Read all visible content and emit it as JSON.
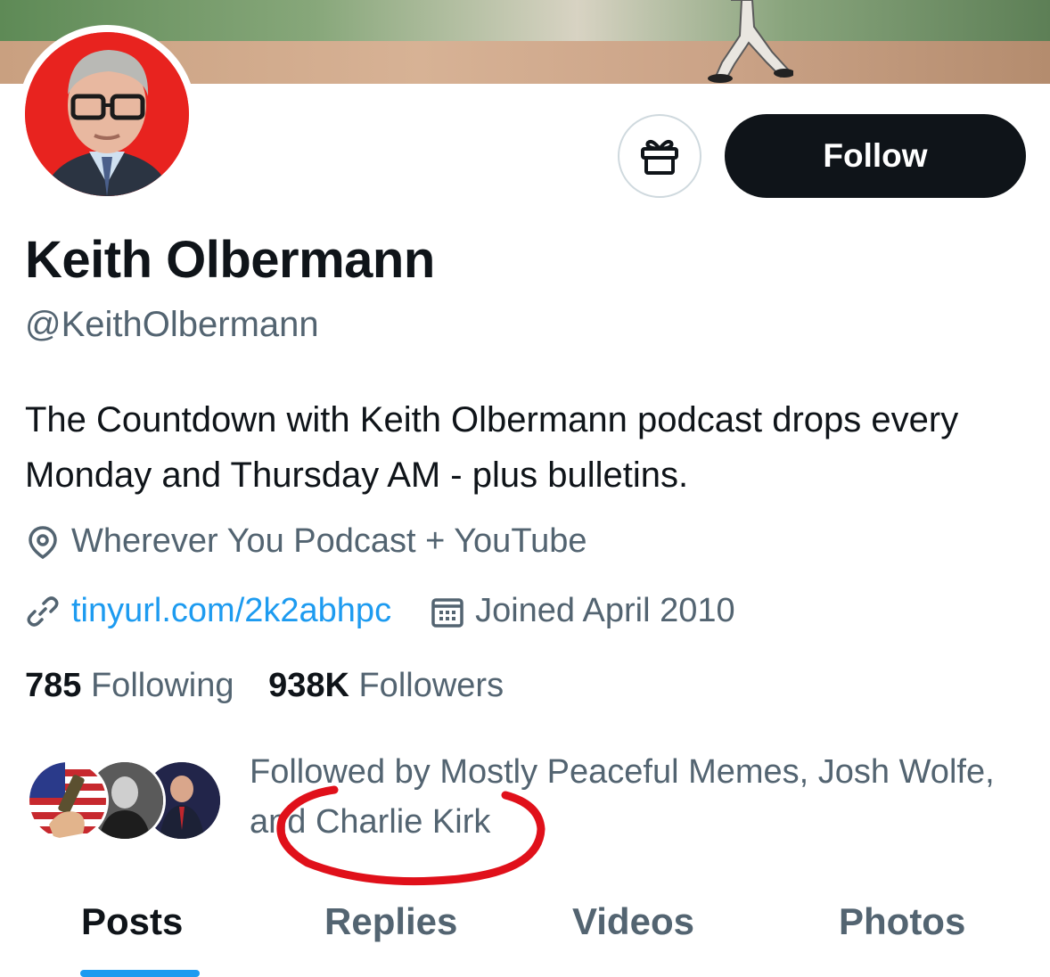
{
  "profile": {
    "name": "Keith Olbermann",
    "handle": "@KeithOlbermann",
    "bio": "The Countdown with Keith Olbermann podcast drops every Monday and Thursday AM - plus bulletins.",
    "location": "Wherever You Podcast + YouTube",
    "website": "tinyurl.com/2k2abhpc",
    "joined": "Joined April 2010"
  },
  "actions": {
    "follow_label": "Follow",
    "gift_icon": "gift-icon"
  },
  "stats": {
    "following_count": "785",
    "following_label": "Following",
    "followers_count": "938K",
    "followers_label": "Followers"
  },
  "followed_by": {
    "text": "Followed by Mostly Peaceful Memes, Josh Wolfe, and Charlie Kirk"
  },
  "tabs": [
    {
      "label": "Posts",
      "active": true
    },
    {
      "label": "Replies",
      "active": false
    },
    {
      "label": "Videos",
      "active": false
    },
    {
      "label": "Photos",
      "active": false
    }
  ],
  "colors": {
    "accent": "#1d9bf0",
    "text_primary": "#0f1419",
    "text_secondary": "#536471",
    "annotation_red": "#e0101a"
  }
}
